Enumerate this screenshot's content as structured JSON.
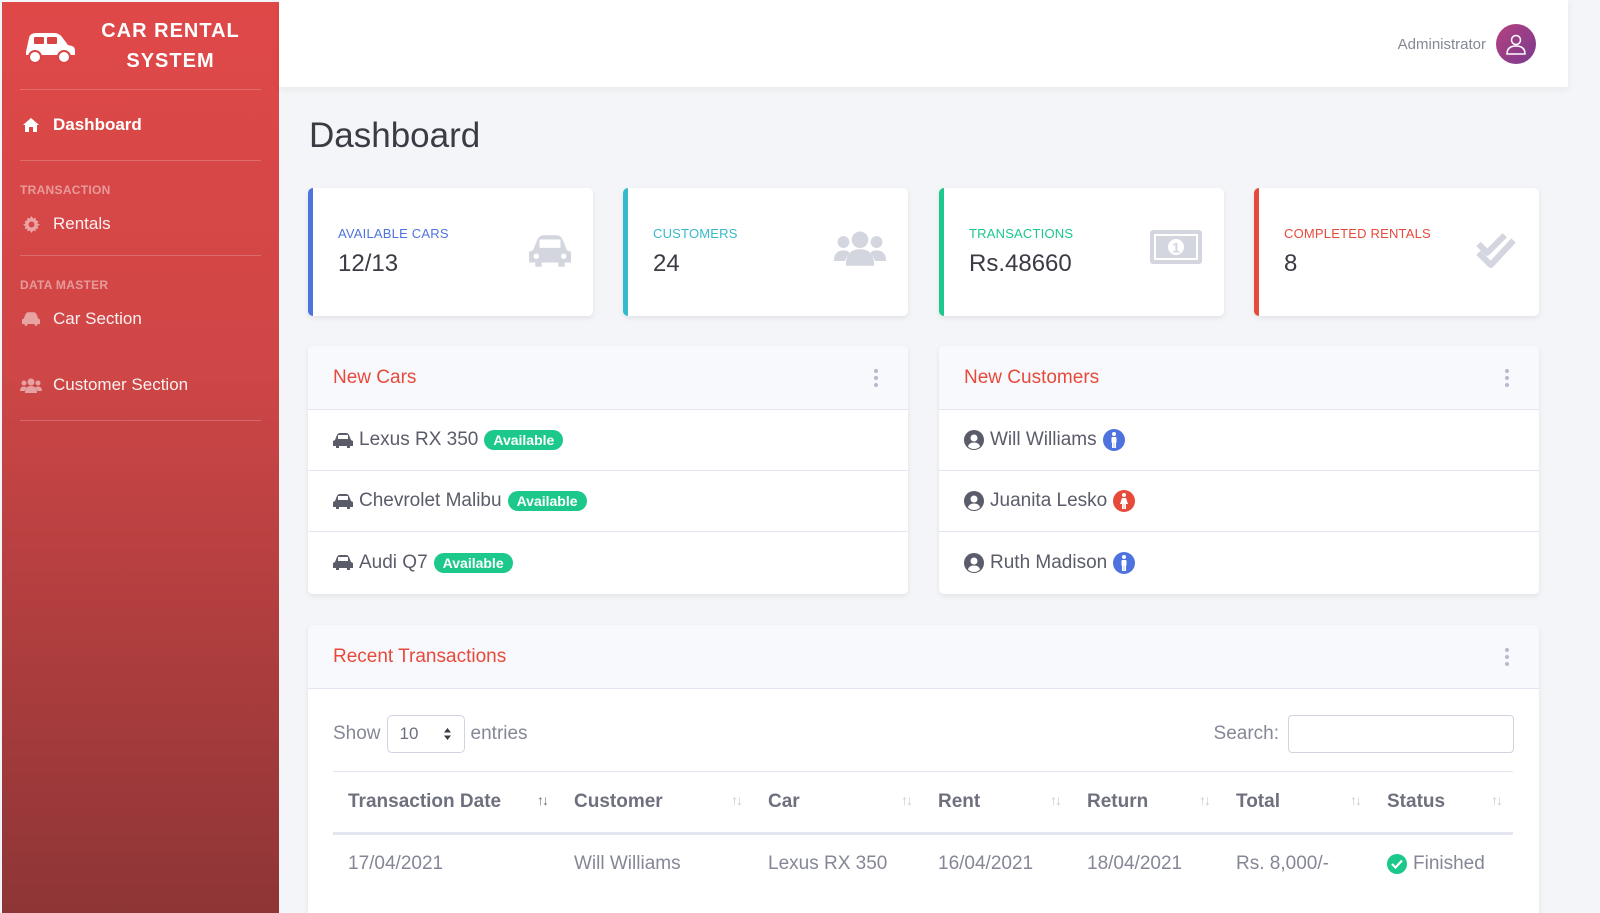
{
  "brand": {
    "line1": "CAR RENTAL",
    "line2": "SYSTEM"
  },
  "sidebar": {
    "dashboard": "Dashboard",
    "heading_transaction": "TRANSACTION",
    "rentals": "Rentals",
    "heading_data_master": "DATA MASTER",
    "car_section": "Car Section",
    "customer_section": "Customer Section"
  },
  "topbar": {
    "user_name": "Administrator"
  },
  "page": {
    "title": "Dashboard"
  },
  "stats": [
    {
      "label": "AVAILABLE CARS",
      "value": "12/13",
      "color": "#4e73df"
    },
    {
      "label": "CUSTOMERS",
      "value": "24",
      "color": "#36b9cc"
    },
    {
      "label": "TRANSACTIONS",
      "value": "Rs.48660",
      "color": "#1cc88a"
    },
    {
      "label": "COMPLETED RENTALS",
      "value": "8",
      "color": "#e74a3b"
    }
  ],
  "new_cars": {
    "title": "New Cars",
    "items": [
      {
        "name": "Lexus RX 350",
        "status": "Available"
      },
      {
        "name": "Chevrolet Malibu",
        "status": "Available"
      },
      {
        "name": "Audi Q7",
        "status": "Available"
      }
    ]
  },
  "new_customers": {
    "title": "New Customers",
    "items": [
      {
        "name": "Will Williams",
        "gender": "male",
        "color": "#4e73df"
      },
      {
        "name": "Juanita Lesko",
        "gender": "female",
        "color": "#e74a3b"
      },
      {
        "name": "Ruth Madison",
        "gender": "male",
        "color": "#4e73df"
      }
    ]
  },
  "transactions": {
    "title": "Recent Transactions",
    "show_label": "Show",
    "entries_value": "10",
    "entries_label": "entries",
    "search_label": "Search:",
    "search_value": "",
    "columns": [
      "Transaction Date",
      "Customer",
      "Car",
      "Rent",
      "Return",
      "Total",
      "Status"
    ],
    "rows": [
      [
        "17/04/2021",
        "Will Williams",
        "Lexus RX 350",
        "16/04/2021",
        "18/04/2021",
        "Rs. 8,000/-",
        "Finished"
      ]
    ]
  },
  "colors": {
    "accent": "#e74a3b",
    "success": "#1cc88a",
    "primary": "#4e73df",
    "info": "#36b9cc"
  }
}
